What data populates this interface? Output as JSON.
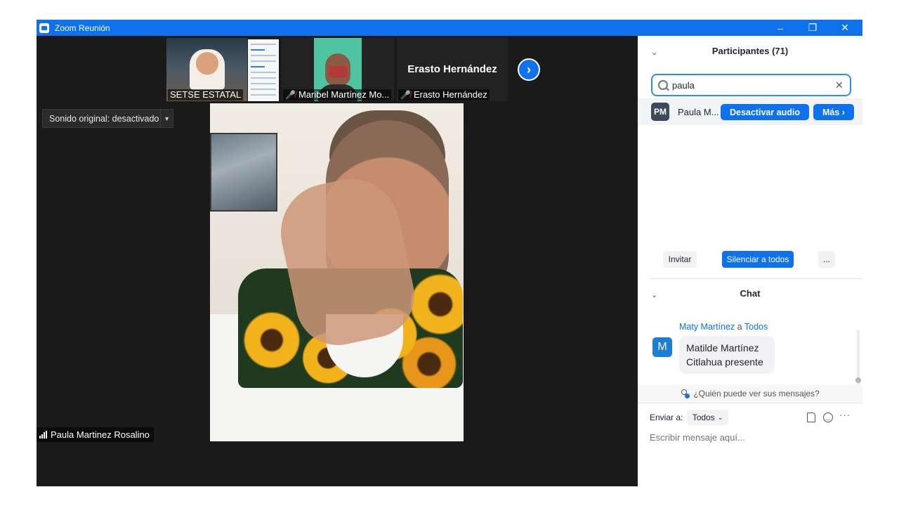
{
  "window": {
    "title": "Zoom Reunión",
    "controls": {
      "minimize": "–",
      "restore": "❐",
      "close": "✕"
    }
  },
  "video": {
    "thumbnails": [
      {
        "name": "SETSE ESTATAL",
        "muted": false
      },
      {
        "name": "Maribel Martínez Mo...",
        "muted": true
      },
      {
        "name": "Erasto Hernández",
        "muted": true,
        "display_name": "Erasto Hernández"
      }
    ],
    "next_icon": "chevron-right",
    "original_sound": "Sonido original: desactivado",
    "active_speaker": "Paula Martinez Rosalino"
  },
  "participants": {
    "title": "Participantes (71)",
    "search_value": "paula",
    "row": {
      "initials": "PM",
      "name": "Paula M...",
      "unmute_label": "Desactivar audio",
      "more_label": "Más ›"
    },
    "invite_label": "Invitar",
    "mute_all_label": "Silenciar a todos",
    "ellipsis_label": "..."
  },
  "chat": {
    "title": "Chat",
    "message": {
      "sender": "Maty Martínez",
      "connector": "a",
      "recipient": "Todos",
      "avatar_initial": "M",
      "text": "Matilde Martínez Citlahua presente"
    },
    "privacy": "¿Quién puede ver sus mensajes?",
    "send_to_label": "Enviar a:",
    "send_to_value": "Todos",
    "input_placeholder": "Escribir mensaje aquí..."
  },
  "colors": {
    "accent": "#0e72ed",
    "video_bg": "#1a1a1a",
    "muted_red": "#e02828"
  }
}
